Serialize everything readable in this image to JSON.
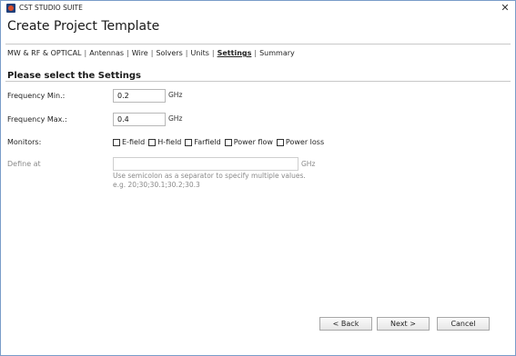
{
  "window": {
    "app_title": "CST STUDIO SUITE",
    "close_glyph": "✕"
  },
  "header": {
    "title": "Create Project Template"
  },
  "breadcrumb": {
    "items": [
      {
        "label": "MW & RF & OPTICAL",
        "active": false
      },
      {
        "label": "Antennas",
        "active": false
      },
      {
        "label": "Wire",
        "active": false
      },
      {
        "label": "Solvers",
        "active": false
      },
      {
        "label": "Units",
        "active": false
      },
      {
        "label": "Settings",
        "active": true
      },
      {
        "label": "Summary",
        "active": false
      }
    ],
    "separator": "|"
  },
  "main": {
    "heading": "Please select the Settings",
    "freq_min": {
      "label": "Frequency Min.:",
      "value": "0.2",
      "unit": "GHz"
    },
    "freq_max": {
      "label": "Frequency Max.:",
      "value": "0.4",
      "unit": "GHz"
    },
    "monitors": {
      "label": "Monitors:",
      "options": [
        {
          "label": "E-field",
          "checked": false
        },
        {
          "label": "H-field",
          "checked": false
        },
        {
          "label": "Farfield",
          "checked": false
        },
        {
          "label": "Power flow",
          "checked": false
        },
        {
          "label": "Power loss",
          "checked": false
        }
      ]
    },
    "define_at": {
      "label": "Define at",
      "value": "",
      "unit": "GHz",
      "hint_line1": "Use semicolon as a separator to specify multiple values.",
      "hint_line2": "e.g. 20;30;30.1;30.2;30.3"
    }
  },
  "footer": {
    "back_label": "< Back",
    "next_label": "Next >",
    "cancel_label": "Cancel"
  }
}
